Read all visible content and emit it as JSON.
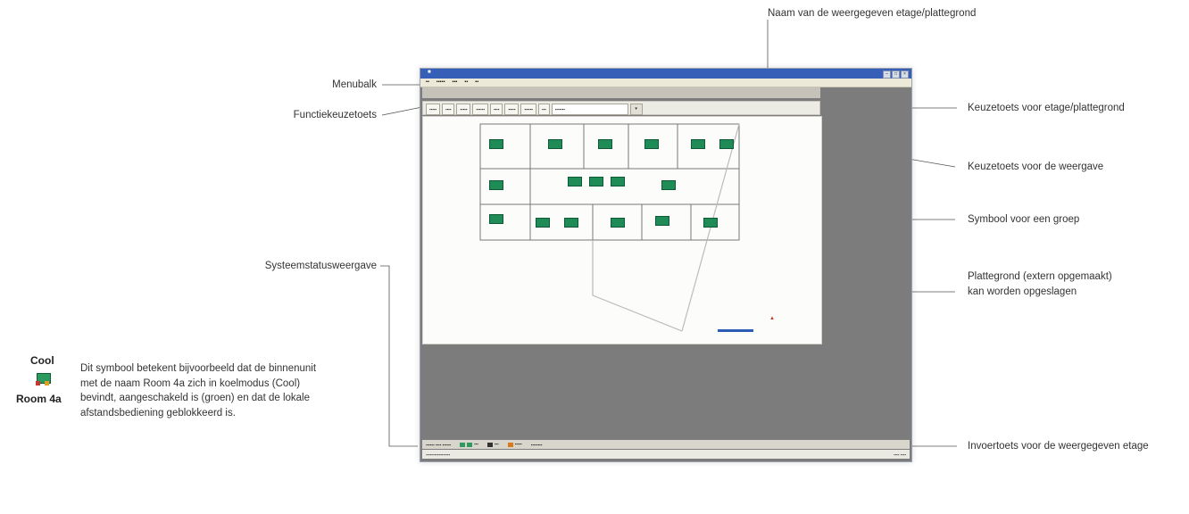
{
  "callouts": {
    "floor_name": "Naam van de weergegeven etage/plattegrond",
    "menubar": "Menubalk",
    "function_keys": "Functiekeuzetoets",
    "floor_select": "Keuzetoets voor etage/plattegrond",
    "view_select": "Keuzetoets voor de weergave",
    "group_symbol": "Symbool voor een groep",
    "system_status": "Systeemstatusweergave",
    "floorplan_line1": "Plattegrond (extern opgemaakt)",
    "floorplan_line2": "kan worden opgeslagen",
    "floor_input": "Invoertoets voor de weergegeven etage"
  },
  "legend": {
    "mode": "Cool",
    "unit_name": "Room 4a",
    "icon": "indoor-unit-icon",
    "description": [
      "Dit symbool betekent bijvoorbeeld dat de binnenunit",
      "met de naam Room 4a zich in koelmodus (Cool)",
      "bevindt, aangeschakeld is (groen) en dat de lokale",
      "afstandsbediening geblokkeerd is."
    ]
  },
  "colors": {
    "unit_on": "#1f8b57",
    "titlebar": "#3660b8",
    "window_bg": "#7c7c7c"
  }
}
